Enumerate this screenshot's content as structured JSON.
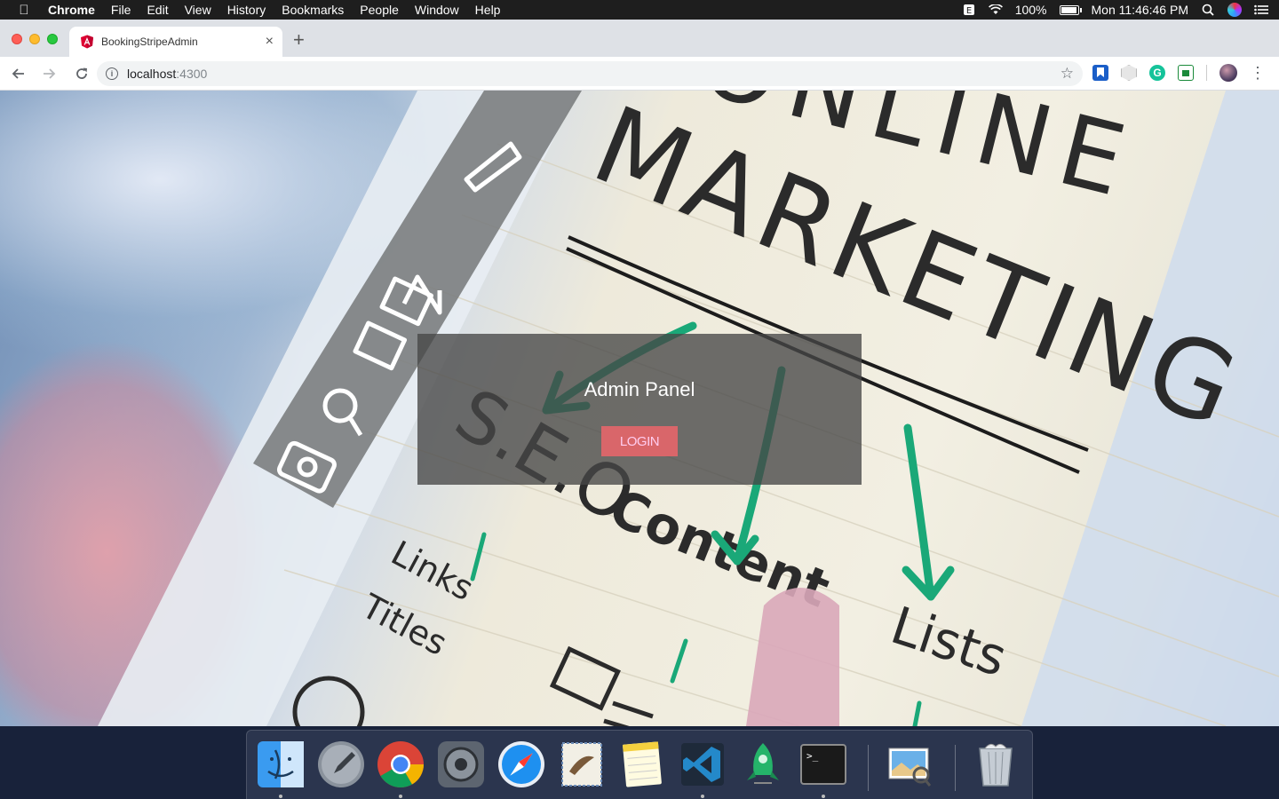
{
  "menubar": {
    "app_name": "Chrome",
    "menus": [
      "File",
      "Edit",
      "View",
      "History",
      "Bookmarks",
      "People",
      "Window",
      "Help"
    ],
    "battery_text": "100%",
    "battery_level": 1.0,
    "clock": "Mon 11:46:46 PM"
  },
  "browser": {
    "tab_title": "BookingStripeAdmin",
    "url_host": "localhost",
    "url_port": ":4300",
    "new_tab_glyph": "+",
    "close_glyph": "×"
  },
  "page": {
    "background_words": {
      "headline_1": "ONLINE",
      "headline_2": "MARKETING",
      "seo": "S.E.O",
      "content": "Content",
      "lists": "Lists",
      "links": "Links",
      "titles": "Titles"
    },
    "panel_title": "Admin Panel",
    "login_label": "LOGIN",
    "accent_color": "#d9666a"
  },
  "dock": {
    "apps": [
      "finder-icon",
      "launchpad-icon",
      "chrome-icon",
      "system-preferences-icon",
      "safari-icon",
      "mail-icon",
      "notes-icon",
      "vscode-icon",
      "robo3t-icon",
      "terminal-icon",
      "preview-icon",
      "trash-icon"
    ],
    "terminal_prompt": ">_"
  }
}
